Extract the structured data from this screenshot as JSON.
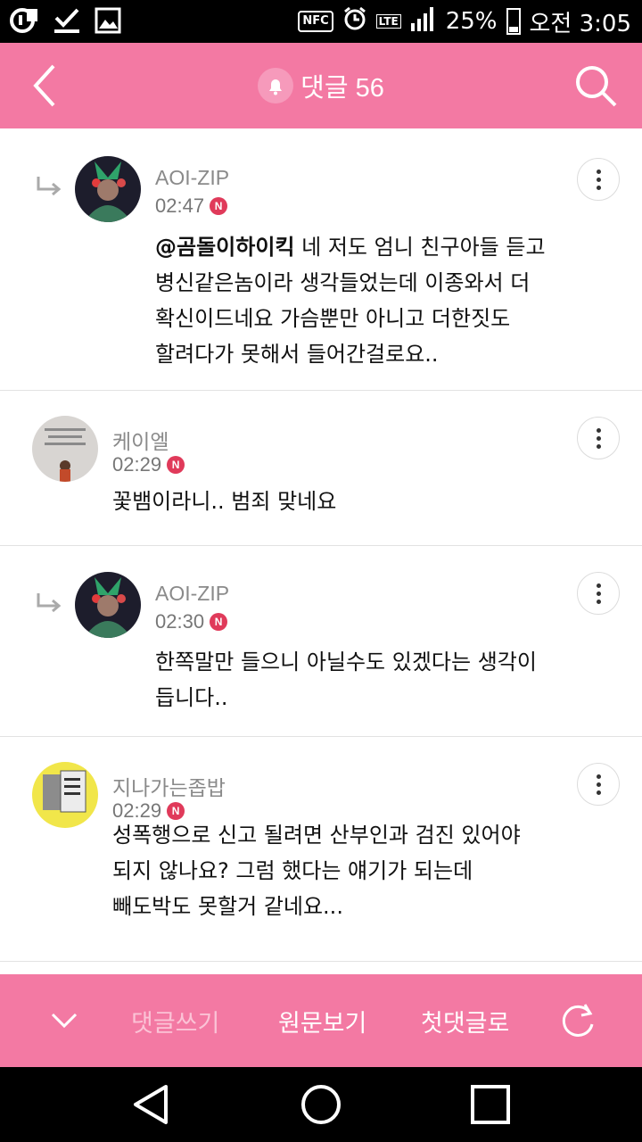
{
  "status_bar": {
    "battery": "25%",
    "time": "오전 3:05",
    "nfc": "NFC",
    "lte": "LTE",
    "battery_level": 0.25
  },
  "header": {
    "title": "댓글 56",
    "accent_color": "#f379a3"
  },
  "comments": [
    {
      "is_reply": true,
      "author": "AOI-ZIP",
      "time": "02:47",
      "badge": "N",
      "mention": "@곰돌이하이킥",
      "lines": [
        "@곰돌이하이킥 네 저도 엄니 친구아들 듣고",
        "병신같은놈이라 생각들었는데 이종와서 더",
        "확신이드네요 가슴뿐만 아니고 더한짓도",
        "할려다가 못해서 들어간걸로요.."
      ],
      "line_rest": "네 저도 엄니 친구아들 듣고"
    },
    {
      "is_reply": false,
      "author": "케이엘",
      "time": "02:29",
      "badge": "N",
      "lines": [
        "꽃뱀이라니.. 범죄 맞네요"
      ]
    },
    {
      "is_reply": true,
      "author": "AOI-ZIP",
      "time": "02:30",
      "badge": "N",
      "lines": [
        "한쪽말만 들으니 아닐수도 있겠다는 생각이",
        "듭니다.."
      ]
    },
    {
      "is_reply": false,
      "author": "지나가는좁밥",
      "time": "02:29",
      "badge": "N",
      "lines": [
        "성폭행으로 신고 될려면 산부인과 검진 있어야",
        "되지 않나요? 그럼 했다는 얘기가 되는데",
        "빼도박도 못할거 같네요..."
      ]
    }
  ],
  "action_bar": {
    "write": "댓글쓰기",
    "original": "원문보기",
    "first": "첫댓글로"
  }
}
